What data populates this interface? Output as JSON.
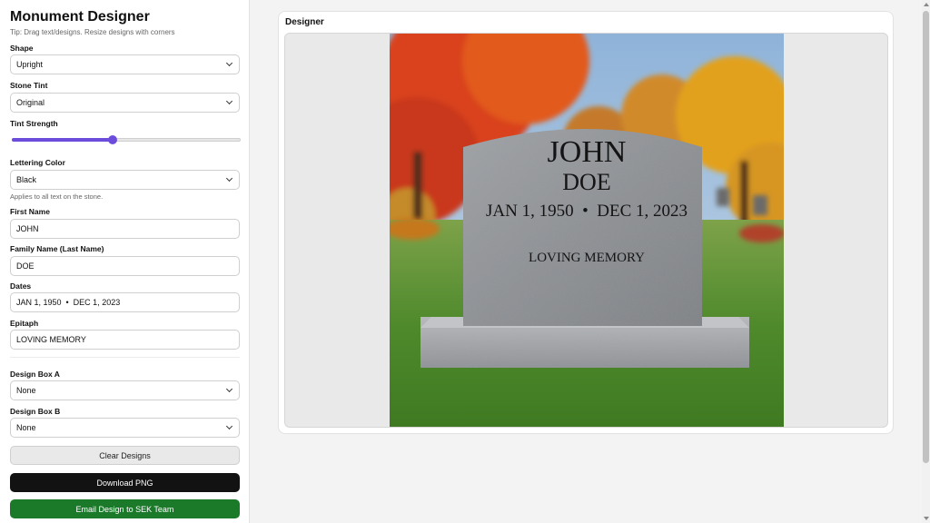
{
  "app": {
    "title": "Monument Designer",
    "tip": "Tip: Drag text/designs. Resize designs with corners"
  },
  "form": {
    "shape": {
      "label": "Shape",
      "value": "Upright"
    },
    "stone_tint": {
      "label": "Stone Tint",
      "value": "Original"
    },
    "tint_strength": {
      "label": "Tint Strength",
      "value": 0.44
    },
    "lettering_color": {
      "label": "Lettering Color",
      "value": "Black",
      "hint": "Applies to all text on the stone."
    },
    "first_name": {
      "label": "First Name",
      "value": "JOHN"
    },
    "family_name": {
      "label": "Family Name (Last Name)",
      "value": "DOE"
    },
    "dates": {
      "label": "Dates",
      "value": "JAN 1, 1950  •  DEC 1, 2023"
    },
    "epitaph": {
      "label": "Epitaph",
      "value": "LOVING MEMORY"
    },
    "design_box_a": {
      "label": "Design Box A",
      "value": "None"
    },
    "design_box_b": {
      "label": "Design Box B",
      "value": "None"
    }
  },
  "buttons": {
    "clear": "Clear Designs",
    "download": "Download PNG",
    "email": "Email Design to SEK Team"
  },
  "designer": {
    "title": "Designer",
    "stone": {
      "first_name": "JOHN",
      "last_name": "DOE",
      "dates": "JAN 1, 1950  •  DEC 1, 2023",
      "epitaph": "LOVING MEMORY"
    }
  },
  "colors": {
    "accent": "#6c4ddb",
    "download_button": "#121212",
    "email_button": "#1a7a2a"
  }
}
